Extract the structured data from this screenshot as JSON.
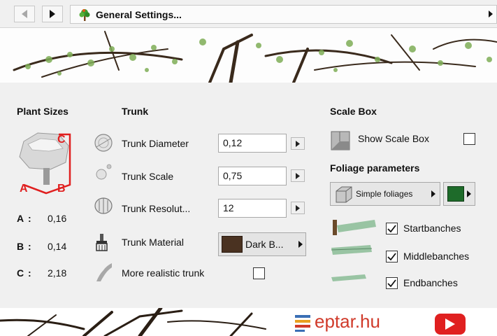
{
  "toolbar": {
    "title": "General Settings...",
    "back_icon": "chevron-left-icon",
    "forward_icon": "chevron-right-icon",
    "tree_icon": "tree-icon"
  },
  "plant_sizes": {
    "header": "Plant Sizes",
    "diagram_labels": {
      "a": "A",
      "b": "B",
      "c": "C"
    },
    "rows": [
      {
        "key": "A",
        "sep": ":",
        "value": "0,16"
      },
      {
        "key": "B",
        "sep": ":",
        "value": "0,14"
      },
      {
        "key": "C",
        "sep": ":",
        "value": "2,18"
      }
    ]
  },
  "trunk": {
    "header": "Trunk",
    "diameter_label": "Trunk Diameter",
    "diameter_value": "0,12",
    "scale_label": "Trunk Scale",
    "scale_value": "0,75",
    "resolution_label": "Trunk Resolut...",
    "resolution_value": "12",
    "material_label": "Trunk Material",
    "material_value": "Dark B...",
    "realistic_label": "More realistic trunk",
    "realistic_checked": false
  },
  "scale_box": {
    "header": "Scale Box",
    "show_label": "Show Scale Box",
    "show_checked": false
  },
  "foliage": {
    "header": "Foliage parameters",
    "type_value": "Simple foliages",
    "color": "#1e6b2a",
    "start_label": "Startbanches",
    "start_checked": true,
    "middle_label": "Middlebanches",
    "middle_checked": true,
    "end_label": "Endbanches",
    "end_checked": true
  },
  "watermark": {
    "site": "eptar.hu"
  },
  "colors": {
    "accent_red": "#e02020",
    "panel_bg": "#f0f0f0",
    "branch_green": "#8fbf9a"
  }
}
